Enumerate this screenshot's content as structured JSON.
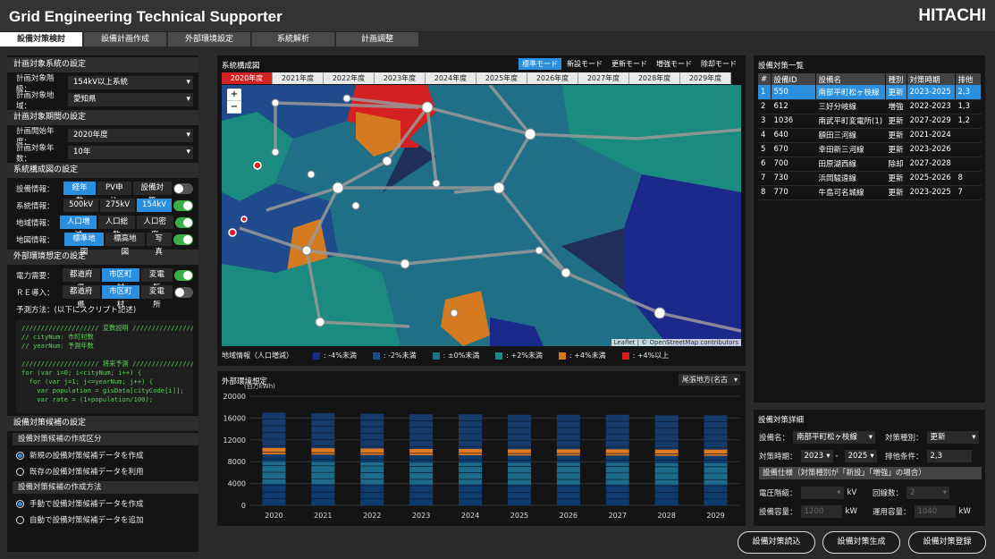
{
  "app": {
    "title": "Grid Engineering Technical Supporter",
    "brand": "HITACHI"
  },
  "tabs": [
    "設備対策検討",
    "設備計画作成",
    "外部環境設定",
    "系統解析",
    "計画調整"
  ],
  "left": {
    "sec1": "計画対象系統の設定",
    "voltage_label": "計画対象階級：",
    "voltage_value": "154kV以上系統",
    "area_label": "計画対象地域：",
    "area_value": "愛知県",
    "sec2": "計画対象期間の設定",
    "start_label": "計画開始年度：",
    "start_value": "2020年度",
    "years_label": "計画対象年数：",
    "years_value": "10年",
    "sec3": "系統構成図の設定",
    "eq_label": "設備情報：",
    "eq_opts": [
      "経年数",
      "PV申込",
      "設備対策"
    ],
    "sys_label": "系統情報：",
    "sys_opts": [
      "500kV",
      "275kV",
      "154kV"
    ],
    "reg_label": "地域情報：",
    "reg_opts": [
      "人口増減",
      "人口総数",
      "人口密度"
    ],
    "map_label": "地図情報：",
    "map_opts": [
      "標準地図",
      "標高地図",
      "写真"
    ],
    "sec4": "外部環境想定の設定",
    "demand_label": "電力需要：",
    "demand_opts": [
      "都道府県",
      "市区町村",
      "変電所"
    ],
    "re_label": "ＲＥ導入：",
    "re_opts": [
      "都道府県",
      "市区町村",
      "変電所"
    ],
    "method_label": "予測方法：(以下にスクリプト記述)",
    "code": "//////////////////// 変数説明 ////////////////////\n// cityNum: 市町村数\n// yearNum: 予測年数\n\n//////////////////// 将来予測 ////////////////////\nfor (var i=0; i<cityNum; i++) {\n  for (var j=1; j<=yearNum; j++) {\n    var population = gisData[cityCode[i]];\n    var rate = (1+population/100);\n    ",
    "sec5": "設備対策候補の設定",
    "sub1": "設備対策候補の作成区分",
    "r1": "新規の設備対策候補データを作成",
    "r2": "既存の設備対策候補データを利用",
    "sub2": "設備対策候補の作成方法",
    "r3": "手動で設備対策候補データを作成",
    "r4": "自動で設備対策候補データを追加"
  },
  "map": {
    "title": "系統構成図",
    "modes": [
      "標準モード",
      "新設モード",
      "更新モード",
      "増強モード",
      "除却モード"
    ],
    "years": [
      "2020年度",
      "2021年度",
      "2022年度",
      "2023年度",
      "2024年度",
      "2025年度",
      "2026年度",
      "2027年度",
      "2028年度",
      "2029年度"
    ],
    "zoom_in": "+",
    "zoom_out": "−",
    "attribution": "Leaflet | © OpenStreetMap contributors",
    "legend_title": "地域情報（人口増減）",
    "legend": [
      {
        "label": ": -4%未満",
        "color": "#1b2a8a"
      },
      {
        "label": ": -2%未満",
        "color": "#1f4b8c"
      },
      {
        "label": ": ±0%未満",
        "color": "#1f6f86"
      },
      {
        "label": ": +2%未満",
        "color": "#1b8a80"
      },
      {
        "label": ": +4%未満",
        "color": "#d47a20"
      },
      {
        "label": ": +4%以上",
        "color": "#d42020"
      }
    ]
  },
  "chart": {
    "title": "外部環境想定",
    "select": "尾張地方(名古",
    "chart_data": {
      "type": "bar",
      "unit": "(百万kWh)",
      "ylim": [
        0,
        20000
      ],
      "yticks": [
        0,
        4000,
        8000,
        12000,
        16000,
        20000
      ],
      "categories": [
        "2020",
        "2021",
        "2022",
        "2023",
        "2024",
        "2025",
        "2026",
        "2027",
        "2028",
        "2029"
      ],
      "values": [
        17000,
        16900,
        16800,
        16700,
        16700,
        16600,
        16600,
        16600,
        16500,
        16500
      ],
      "colors": [
        "#0e3b6e",
        "#1d6a8a",
        "#1f8a80",
        "#e07a20",
        "#163a6a"
      ]
    }
  },
  "list": {
    "title": "設備対策一覧",
    "headers": [
      "#",
      "設備ID",
      "設備名",
      "種別",
      "対策時期",
      "排他"
    ],
    "rows": [
      [
        "1",
        "550",
        "南部平町松ヶ枝線",
        "更新",
        "2023-2025",
        "2,3"
      ],
      [
        "2",
        "612",
        "三好分岐線",
        "増強",
        "2022-2023",
        "1,3"
      ],
      [
        "3",
        "1036",
        "南武平町変電所(1)",
        "更新",
        "2027-2029",
        "1,2"
      ],
      [
        "4",
        "640",
        "額田三河線",
        "更新",
        "2021-2024",
        ""
      ],
      [
        "5",
        "670",
        "幸田新三河線",
        "更新",
        "2023-2026",
        ""
      ],
      [
        "6",
        "700",
        "田原湖西線",
        "除却",
        "2027-2028",
        ""
      ],
      [
        "7",
        "730",
        "浜岡駿遠線",
        "更新",
        "2025-2026",
        "8"
      ],
      [
        "8",
        "770",
        "牛島可名城線",
        "更新",
        "2023-2025",
        "7"
      ]
    ]
  },
  "detail": {
    "title": "設備対策詳細",
    "name_label": "設備名：",
    "name_value": "南部平町松ヶ枝線",
    "type_label": "対策種別：",
    "type_value": "更新",
    "period_label": "対策時期：",
    "period_from": "2023",
    "period_sep": "-",
    "period_to": "2025",
    "excl_label": "排他条件：",
    "excl_value": "2,3",
    "spec_title": "設備仕様（対策種別が「新設」「増強」の場合）",
    "volt_label": "電圧階級：",
    "volt_unit": "kV",
    "circ_label": "回線数：",
    "circ_value": "2",
    "cap_label": "設備容量：",
    "cap_value": "1200",
    "cap_unit": "kW",
    "op_label": "運用容量：",
    "op_value": "1040",
    "op_unit": "kW"
  },
  "buttons": [
    "設備対策読込",
    "設備対策生成",
    "設備対策登録"
  ]
}
